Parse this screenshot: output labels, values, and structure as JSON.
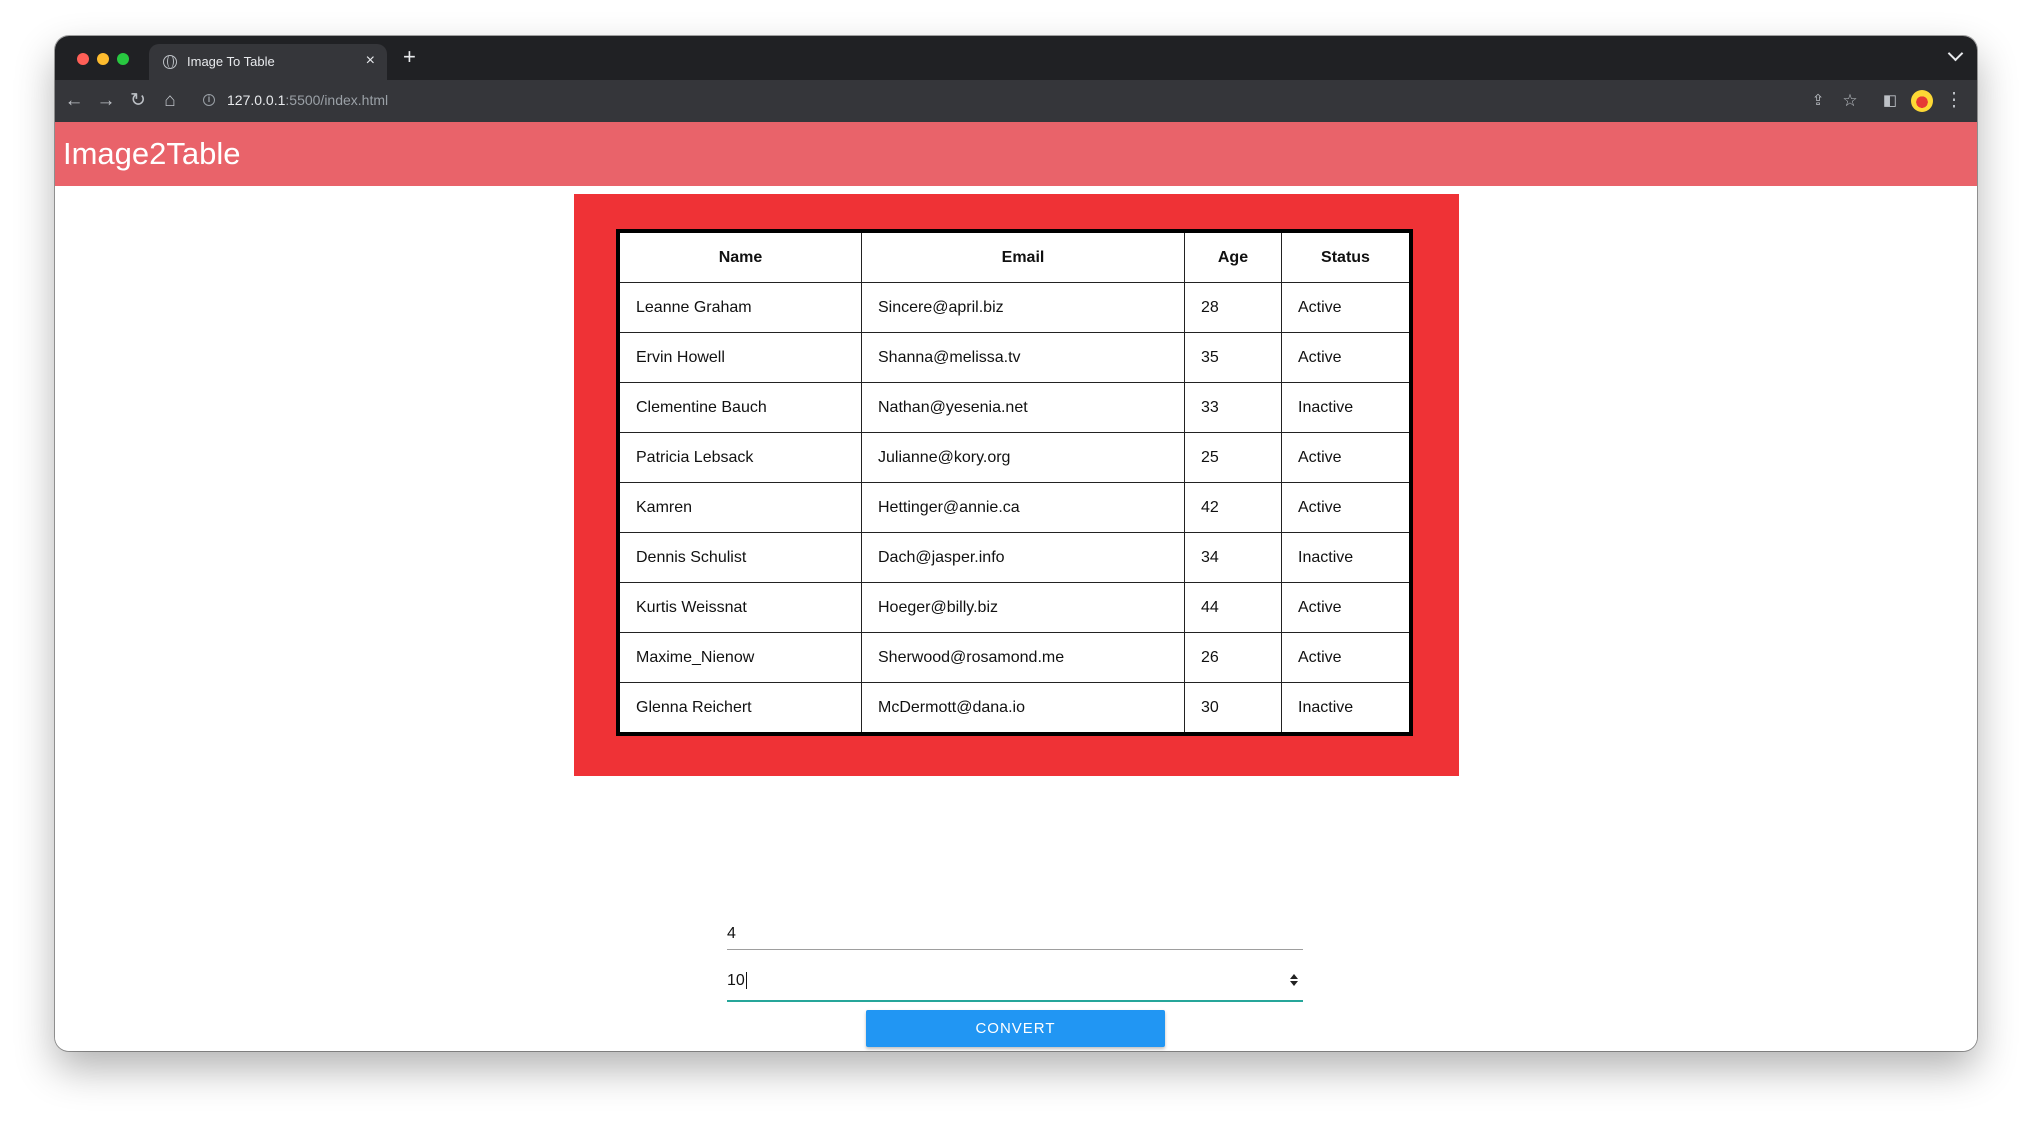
{
  "browser": {
    "tab_title": "Image To Table",
    "tab_close": "×",
    "new_tab": "+",
    "url_host": "127.0.0.1",
    "url_path": ":5500/index.html"
  },
  "app": {
    "title": "Image2Table",
    "accent_color": "#e9636a",
    "frame_color": "#ef3236",
    "button_color": "#2196f3"
  },
  "table": {
    "headers": [
      "Name",
      "Email",
      "Age",
      "Status"
    ],
    "rows": [
      [
        "Leanne Graham",
        "Sincere@april.biz",
        "28",
        "Active"
      ],
      [
        "Ervin Howell",
        "Shanna@melissa.tv",
        "35",
        "Active"
      ],
      [
        "Clementine Bauch",
        "Nathan@yesenia.net",
        "33",
        "Inactive"
      ],
      [
        "Patricia Lebsack",
        "Julianne@kory.org",
        "25",
        "Active"
      ],
      [
        "Kamren",
        "Hettinger@annie.ca",
        "42",
        "Active"
      ],
      [
        "Dennis Schulist",
        "Dach@jasper.info",
        "34",
        "Inactive"
      ],
      [
        "Kurtis Weissnat",
        "Hoeger@billy.biz",
        "44",
        "Active"
      ],
      [
        "Maxime_Nienow",
        "Sherwood@rosamond.me",
        "26",
        "Active"
      ],
      [
        "Glenna Reichert",
        "McDermott@dana.io",
        "30",
        "Inactive"
      ]
    ]
  },
  "form": {
    "rows_value": "4",
    "cols_value": "10",
    "convert_label": "CONVERT"
  }
}
